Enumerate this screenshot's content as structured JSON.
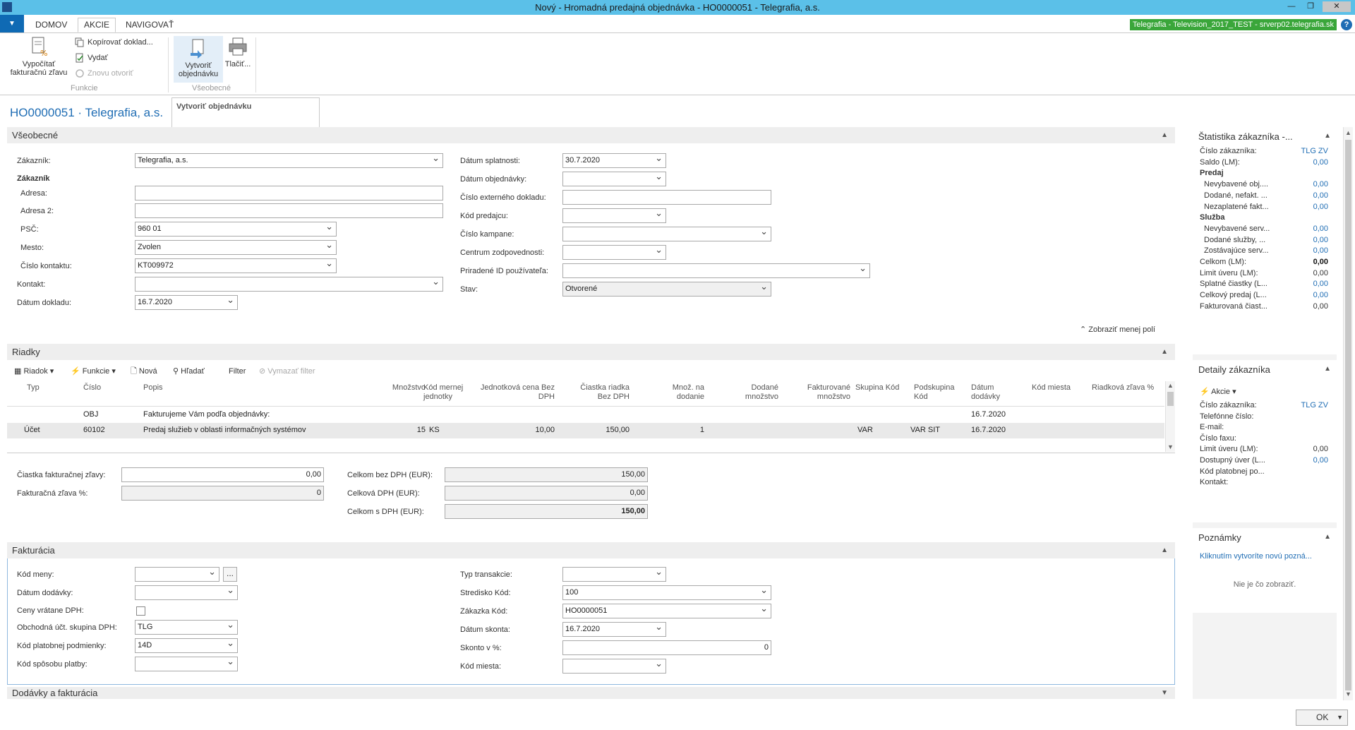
{
  "window": {
    "title": "Nový - Hromadná predajná objednávka - HO0000051 - Telegrafia, a.s."
  },
  "tabs": [
    "DOMOV",
    "AKCIE",
    "NAVIGOVAŤ"
  ],
  "server_badge": "Telegrafia - Television_2017_TEST - srverp02.telegrafia.sk",
  "ribbon": {
    "calc_discount": "Vypočítať fakturačnú zľavu",
    "copy_doc": "Kopírovať doklad...",
    "release": "Vydať",
    "reopen": "Znovu otvoriť",
    "group_funkcie": "Funkcie",
    "create_order": "Vytvoriť objednávku",
    "print": "Tlačiť...",
    "group_vseobecne": "Všeobecné",
    "tooltip": "Vytvoriť objednávku"
  },
  "page_title": "HO0000051 · Telegrafia, a.s.",
  "general": {
    "header": "Všeobecné",
    "customer_label": "Zákazník:",
    "customer_value": "Telegrafia, a.s.",
    "customer_section": "Zákazník",
    "address_label": "Adresa:",
    "address_value": "",
    "address2_label": "Adresa 2:",
    "address2_value": "",
    "zip_label": "PSČ:",
    "zip_value": "960 01",
    "city_label": "Mesto:",
    "city_value": "Zvolen",
    "contact_no_label": "Číslo kontaktu:",
    "contact_no_value": "KT009972",
    "contact_label": "Kontakt:",
    "contact_value": "",
    "doc_date_label": "Dátum dokladu:",
    "doc_date_value": "16.7.2020",
    "due_date_label": "Dátum splatnosti:",
    "due_date_value": "30.7.2020",
    "order_date_label": "Dátum objednávky:",
    "order_date_value": "",
    "ext_doc_label": "Číslo externého dokladu:",
    "ext_doc_value": "",
    "salesperson_label": "Kód predajcu:",
    "salesperson_value": "",
    "campaign_label": "Číslo kampane:",
    "campaign_value": "",
    "resp_center_label": "Centrum zodpovednosti:",
    "resp_center_value": "",
    "user_id_label": "Priradené ID používateľa:",
    "user_id_value": "",
    "status_label": "Stav:",
    "status_value": "Otvorené",
    "show_fewer": "Zobraziť menej polí"
  },
  "lines": {
    "header": "Riadky",
    "toolbar": [
      "Riadok",
      "Funkcie",
      "Nová",
      "Hľadať",
      "Filter",
      "Vymazať filter"
    ],
    "columns": {
      "typ": "Typ",
      "cislo": "Číslo",
      "popis": "Popis",
      "mnozstvo": "Množstvo",
      "kod_mernej": "Kód mernej jednotky",
      "jedn_cena": "Jednotková cena Bez DPH",
      "ciastka_riadka": "Čiastka riadka Bez DPH",
      "mnoz_dodanie": "Množ. na dodanie",
      "dodane": "Dodané množstvo",
      "fakturovane": "Fakturované množstvo",
      "skupina_kod": "Skupina Kód",
      "podskupina_kod": "Podskupina Kód",
      "datum_dodavky": "Dátum dodávky",
      "kod_miesta": "Kód miesta",
      "riadkova_zlava": "Riadková zľava %"
    },
    "rows": [
      {
        "typ": "",
        "cislo": "OBJ",
        "popis": "Fakturujeme Vám podľa objednávky:",
        "mnozstvo": "",
        "kod_mernej": "",
        "jedn_cena": "",
        "ciastka_riadka": "",
        "mnoz_dodanie": "",
        "skupina_kod": "",
        "podskupina_kod": "",
        "datum_dodavky": "16.7.2020"
      },
      {
        "typ": "Účet",
        "cislo": "60102",
        "popis": "Predaj služieb v oblasti informačných systémov",
        "mnozstvo": "15",
        "kod_mernej": "KS",
        "jedn_cena": "10,00",
        "ciastka_riadka": "150,00",
        "mnoz_dodanie": "1",
        "skupina_kod": "VAR",
        "podskupina_kod": "VAR SIT",
        "datum_dodavky": "16.7.2020"
      }
    ]
  },
  "totals": {
    "inv_disc_amount_label": "Čiastka fakturačnej zľavy:",
    "inv_disc_amount_value": "0,00",
    "inv_disc_pct_label": "Fakturačná zľava %:",
    "inv_disc_pct_value": "0",
    "total_excl_label": "Celkom bez DPH (EUR):",
    "total_excl_value": "150,00",
    "total_vat_label": "Celková DPH (EUR):",
    "total_vat_value": "0,00",
    "total_incl_label": "Celkom s DPH (EUR):",
    "total_incl_value": "150,00"
  },
  "invoicing": {
    "header": "Fakturácia",
    "currency_label": "Kód meny:",
    "currency_value": "",
    "ellipsis": "...",
    "shipment_date_label": "Dátum dodávky:",
    "shipment_date_value": "",
    "prices_incl_vat_label": "Ceny vrátane DPH:",
    "vat_bus_group_label": "Obchodná účt. skupina DPH:",
    "vat_bus_group_value": "TLG",
    "payment_terms_label": "Kód platobnej podmienky:",
    "payment_terms_value": "14D",
    "payment_method_label": "Kód spôsobu platby:",
    "payment_method_value": "",
    "transaction_type_label": "Typ transakcie:",
    "transaction_type_value": "",
    "dept_code_label": "Stredisko Kód:",
    "dept_code_value": "100",
    "job_code_label": "Zákazka Kód:",
    "job_code_value": "HO0000051",
    "pmt_disc_date_label": "Dátum skonta:",
    "pmt_disc_date_value": "16.7.2020",
    "pmt_disc_pct_label": "Skonto v %:",
    "pmt_disc_pct_value": "0",
    "location_label": "Kód miesta:",
    "location_value": ""
  },
  "next_section_header": "Dodávky a fakturácia",
  "factbox": {
    "stats_title": "Štatistika zákazníka -...",
    "stats": [
      {
        "label": "Číslo zákazníka:",
        "value": "TLG ZV",
        "kind": "link",
        "indent": false
      },
      {
        "label": "Saldo (LM):",
        "value": "0,00",
        "kind": "link",
        "indent": false
      },
      {
        "label": "Predaj",
        "value": "",
        "kind": "section",
        "indent": false
      },
      {
        "label": "Nevybavené obj....",
        "value": "0,00",
        "kind": "link",
        "indent": true
      },
      {
        "label": "Dodané, nefakt. ...",
        "value": "0,00",
        "kind": "link",
        "indent": true
      },
      {
        "label": "Nezaplatené fakt...",
        "value": "0,00",
        "kind": "link",
        "indent": true
      },
      {
        "label": "Služba",
        "value": "",
        "kind": "section",
        "indent": false
      },
      {
        "label": "Nevybavené serv...",
        "value": "0,00",
        "kind": "link",
        "indent": true
      },
      {
        "label": "Dodané služby, ...",
        "value": "0,00",
        "kind": "link",
        "indent": true
      },
      {
        "label": "Zostávajúce serv...",
        "value": "0,00",
        "kind": "link",
        "indent": true
      },
      {
        "label": "Celkom (LM):",
        "value": "0,00",
        "kind": "bold",
        "indent": false
      },
      {
        "label": "Limit úveru (LM):",
        "value": "0,00",
        "kind": "plain",
        "indent": false
      },
      {
        "label": "Splatné čiastky (L...",
        "value": "0,00",
        "kind": "link",
        "indent": false
      },
      {
        "label": "Celkový predaj (L...",
        "value": "0,00",
        "kind": "link",
        "indent": false
      },
      {
        "label": "Fakturovaná čiast...",
        "value": "0,00",
        "kind": "plain",
        "indent": false
      }
    ],
    "details_title": "Detaily zákazníka",
    "details_action": "Akcie",
    "details": [
      {
        "label": "Číslo zákazníka:",
        "value": "TLG ZV",
        "kind": "link"
      },
      {
        "label": "Telefónne číslo:",
        "value": "",
        "kind": "plain"
      },
      {
        "label": "E-mail:",
        "value": "",
        "kind": "plain"
      },
      {
        "label": "Číslo faxu:",
        "value": "",
        "kind": "plain"
      },
      {
        "label": "Limit úveru (LM):",
        "value": "0,00",
        "kind": "plain"
      },
      {
        "label": "Dostupný úver (L...",
        "value": "0,00",
        "kind": "link"
      },
      {
        "label": "Kód platobnej po...",
        "value": "",
        "kind": "plain"
      },
      {
        "label": "Kontakt:",
        "value": "",
        "kind": "plain"
      }
    ],
    "notes_title": "Poznámky",
    "notes_link": "Kliknutím vytvoríte novú pozná...",
    "notes_empty": "Nie je čo zobraziť."
  },
  "ok_button": "OK"
}
